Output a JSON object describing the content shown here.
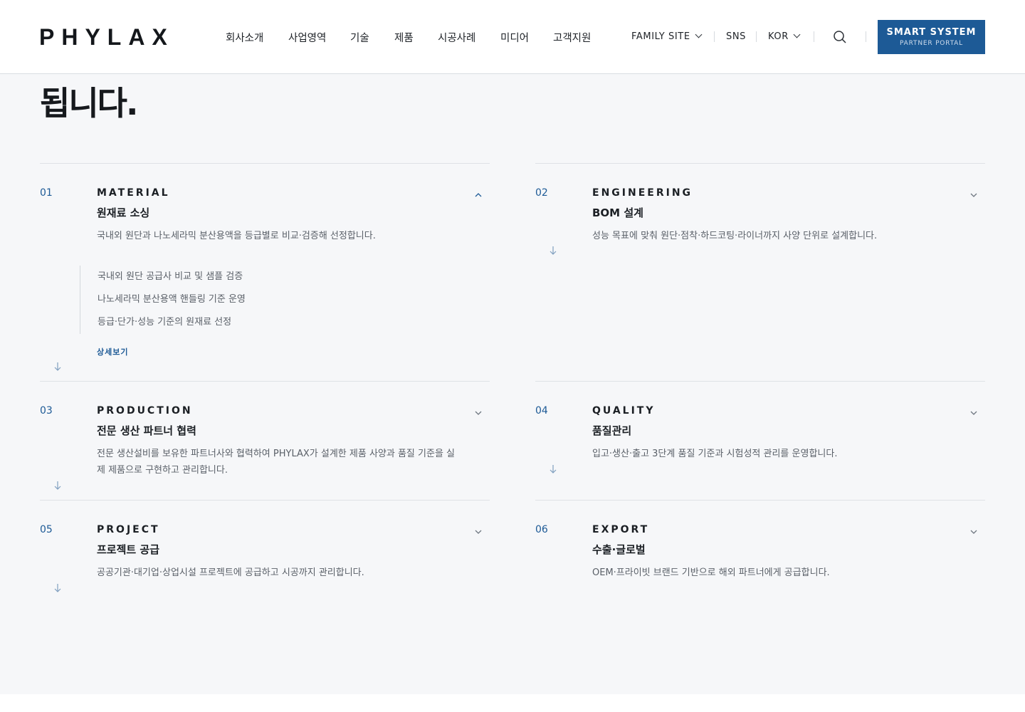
{
  "header": {
    "logo": "PHYLAX",
    "nav": [
      "회사소개",
      "사업영역",
      "기술",
      "제품",
      "시공사례",
      "미디어",
      "고객지원"
    ],
    "family_site": "FAMILY SITE",
    "sns": "SNS",
    "language": "KOR",
    "cta_title": "SMART SYSTEM",
    "cta_subtitle": "PARTNER PORTAL"
  },
  "hero": {
    "line2": "됩니다."
  },
  "services": [
    {
      "num": "01",
      "eng": "MATERIAL",
      "kor": "원재료 소싱",
      "desc": "국내외 원단과 나노세라믹 분산용액을 등급별로 비교·검증해 선정합니다.",
      "expanded": true,
      "sub_items": [
        "국내외 원단 공급사 비교 및 샘플 검증",
        "나노세라믹 분산용액 핸들링 기준 운영",
        "등급·단가·성능 기준의 원재료 선정"
      ],
      "more": "상세보기"
    },
    {
      "num": "02",
      "eng": "ENGINEERING",
      "kor": "BOM 설계",
      "desc": "성능 목표에 맞춰 원단·점착·하드코팅·라이너까지 사양 단위로 설계합니다.",
      "expanded": false
    },
    {
      "num": "03",
      "eng": "PRODUCTION",
      "kor": "전문 생산 파트너 협력",
      "desc": "전문 생산설비를 보유한 파트너사와 협력하여 PHYLAX가 설계한 제품 사양과 품질 기준을 실제 제품으로 구현하고 관리합니다.",
      "expanded": false
    },
    {
      "num": "04",
      "eng": "QUALITY",
      "kor": "품질관리",
      "desc": "입고·생산·출고 3단계 품질 기준과 시험성적 관리를 운영합니다.",
      "expanded": false
    },
    {
      "num": "05",
      "eng": "PROJECT",
      "kor": "프로젝트 공급",
      "desc": "공공기관·대기업·상업시설 프로젝트에 공급하고 시공까지 관리합니다.",
      "expanded": false
    },
    {
      "num": "06",
      "eng": "EXPORT",
      "kor": "수출·글로벌",
      "desc": "OEM·프라이빗 브랜드 기반으로 해외 파트너에게 공급합니다.",
      "expanded": false
    }
  ],
  "colors": {
    "accent": "#1d5a96",
    "background": "#f6f7f9"
  },
  "icons": [
    "search-icon",
    "chevron-down-icon",
    "chevron-up-icon",
    "arrow-down-icon"
  ]
}
